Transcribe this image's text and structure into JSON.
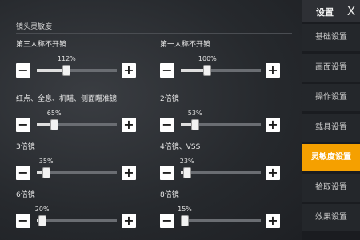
{
  "section": {
    "title": "镜头灵敏度"
  },
  "sliders": [
    {
      "label": "第三人称不开镜",
      "value": 112,
      "display": "112%"
    },
    {
      "label": "第一人称不开镜",
      "value": 100,
      "display": "100%"
    },
    {
      "label": "红点、全息、机瞄、侧面瞄准镜",
      "value": 65,
      "display": "65%"
    },
    {
      "label": "2倍镜",
      "value": 53,
      "display": "53%"
    },
    {
      "label": "3倍镜",
      "value": 35,
      "display": "35%"
    },
    {
      "label": "4倍镜、VSS",
      "value": 23,
      "display": "23%"
    },
    {
      "label": "6倍镜",
      "value": 20,
      "display": "20%"
    },
    {
      "label": "8倍镜",
      "value": 15,
      "display": "15%"
    }
  ],
  "slider_range": [
    0,
    300
  ],
  "buttons": {
    "minus": "−",
    "plus": "+"
  },
  "sidebar": {
    "title": "设置",
    "close": "X",
    "items": [
      {
        "label": "基础设置",
        "active": false
      },
      {
        "label": "画面设置",
        "active": false
      },
      {
        "label": "操作设置",
        "active": false
      },
      {
        "label": "载具设置",
        "active": false
      },
      {
        "label": "灵敏度设置",
        "active": true
      },
      {
        "label": "拾取设置",
        "active": false
      },
      {
        "label": "效果设置",
        "active": false
      }
    ]
  },
  "colors": {
    "accent": "#f5a000",
    "sidebar_bg": "#1a1c20",
    "track": "#6a6d72"
  }
}
